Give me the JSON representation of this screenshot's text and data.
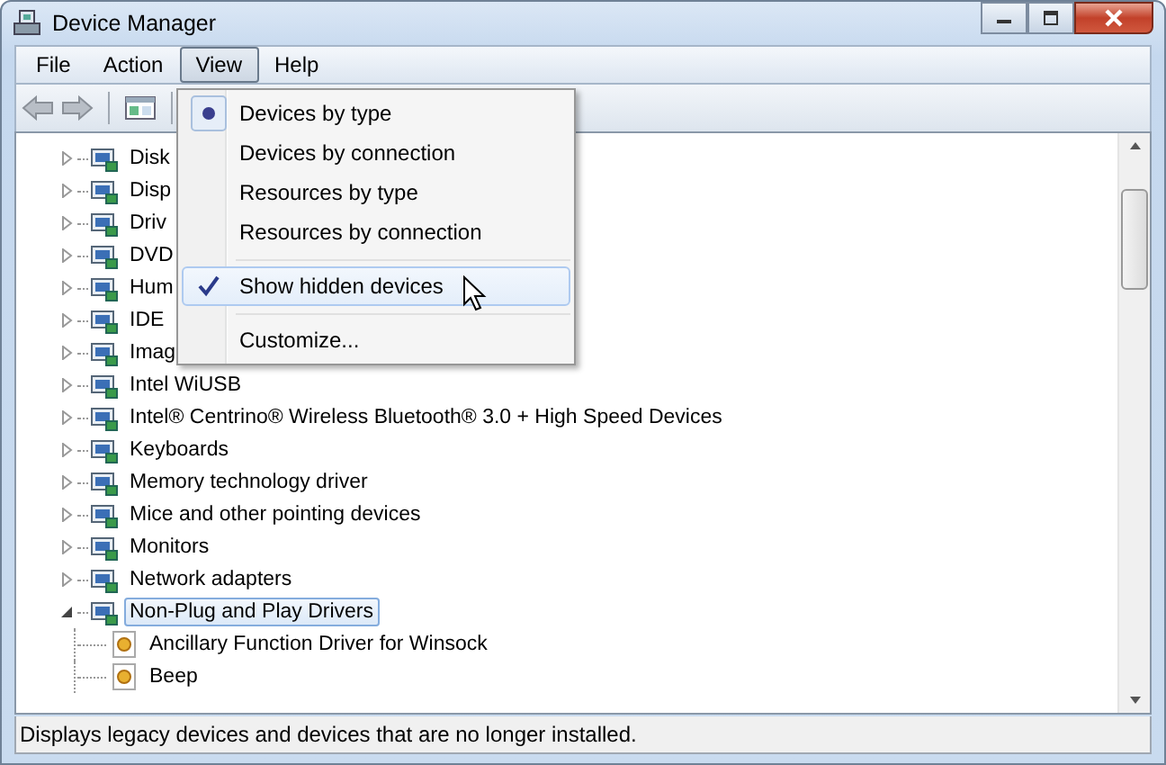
{
  "window": {
    "title": "Device Manager"
  },
  "menu_bar": [
    {
      "label": "File",
      "selected": false
    },
    {
      "label": "Action",
      "selected": false
    },
    {
      "label": "View",
      "selected": true
    },
    {
      "label": "Help",
      "selected": false
    }
  ],
  "view_menu": [
    {
      "kind": "radio",
      "label": "Devices by type",
      "selected": true,
      "highlighted": false
    },
    {
      "kind": "radio",
      "label": "Devices by connection",
      "selected": false,
      "highlighted": false
    },
    {
      "kind": "radio",
      "label": "Resources by type",
      "selected": false,
      "highlighted": false
    },
    {
      "kind": "radio",
      "label": "Resources by connection",
      "selected": false,
      "highlighted": false
    },
    {
      "kind": "separator"
    },
    {
      "kind": "check",
      "label": "Show hidden devices",
      "checked": true,
      "highlighted": true
    },
    {
      "kind": "separator"
    },
    {
      "kind": "plain",
      "label": "Customize...",
      "highlighted": false
    }
  ],
  "tree": [
    {
      "label": "Disk",
      "expanded": false,
      "selected": false
    },
    {
      "label": "Disp",
      "expanded": false,
      "selected": false
    },
    {
      "label": "Driv",
      "expanded": false,
      "selected": false
    },
    {
      "label": "DVD",
      "expanded": false,
      "selected": false
    },
    {
      "label": "Hum",
      "expanded": false,
      "selected": false
    },
    {
      "label": "IDE",
      "expanded": false,
      "selected": false
    },
    {
      "label": "Imag",
      "expanded": false,
      "selected": false
    },
    {
      "label": "Intel WiUSB",
      "expanded": false,
      "selected": false
    },
    {
      "label": "Intel® Centrino® Wireless Bluetooth® 3.0 + High Speed Devices",
      "expanded": false,
      "selected": false
    },
    {
      "label": "Keyboards",
      "expanded": false,
      "selected": false
    },
    {
      "label": "Memory technology driver",
      "expanded": false,
      "selected": false
    },
    {
      "label": "Mice and other pointing devices",
      "expanded": false,
      "selected": false
    },
    {
      "label": "Monitors",
      "expanded": false,
      "selected": false
    },
    {
      "label": "Network adapters",
      "expanded": false,
      "selected": false
    },
    {
      "label": "Non-Plug and Play Drivers",
      "expanded": true,
      "selected": true,
      "children": [
        {
          "label": "Ancillary Function Driver for Winsock",
          "selected": false
        },
        {
          "label": "Beep",
          "selected": false
        }
      ]
    }
  ],
  "status_bar": "Displays legacy devices and devices that are no longer installed."
}
